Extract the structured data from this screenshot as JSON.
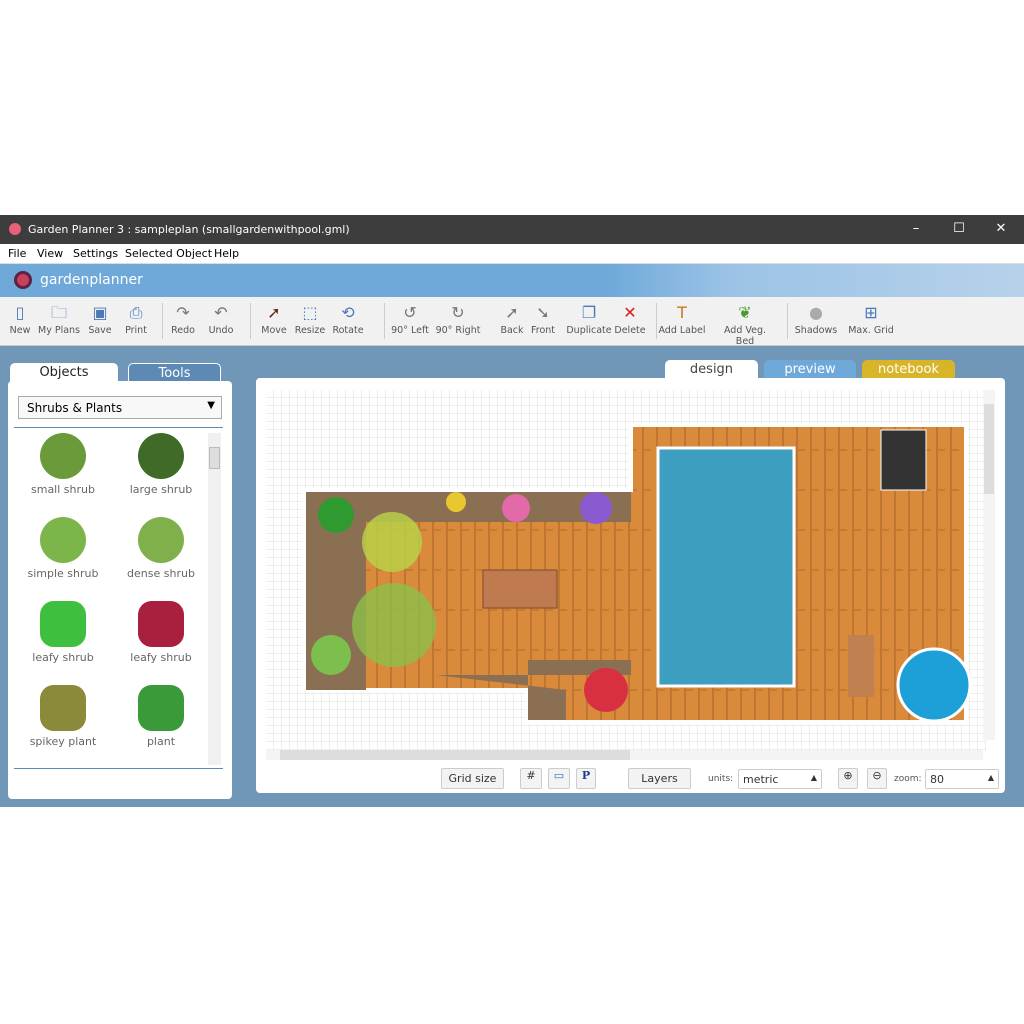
{
  "window": {
    "title": "Garden Planner 3 : sampleplan (smallgardenwithpool.gml)",
    "minimize": "–",
    "maximize": "☐",
    "close": "✕"
  },
  "menu": [
    "File",
    "View",
    "Settings",
    "Selected Object",
    "Help"
  ],
  "brand": "gardenplanner",
  "toolbar": [
    {
      "label": "New",
      "icon": "new-document-icon",
      "glyph": "▯"
    },
    {
      "label": "My Plans",
      "icon": "folder-icon",
      "glyph": "🗀"
    },
    {
      "label": "Save",
      "icon": "save-icon",
      "glyph": "▣"
    },
    {
      "label": "Print",
      "icon": "print-icon",
      "glyph": "⎙"
    },
    {
      "label": "Redo",
      "icon": "redo-icon",
      "glyph": "↷"
    },
    {
      "label": "Undo",
      "icon": "undo-icon",
      "glyph": "↶"
    },
    {
      "label": "Move",
      "icon": "arrow-cursor-icon",
      "glyph": "➚"
    },
    {
      "label": "Resize",
      "icon": "resize-icon",
      "glyph": "⬚"
    },
    {
      "label": "Rotate",
      "icon": "rotate-icon",
      "glyph": "⟲"
    },
    {
      "label": "90° Left",
      "icon": "rotate-left-icon",
      "glyph": "↺"
    },
    {
      "label": "90° Right",
      "icon": "rotate-right-icon",
      "glyph": "↻"
    },
    {
      "label": "Back",
      "icon": "send-back-icon",
      "glyph": "➚"
    },
    {
      "label": "Front",
      "icon": "bring-front-icon",
      "glyph": "➘"
    },
    {
      "label": "Duplicate",
      "icon": "duplicate-icon",
      "glyph": "❐"
    },
    {
      "label": "Delete",
      "icon": "delete-icon",
      "glyph": "✕"
    },
    {
      "label": "Add Label",
      "icon": "text-label-icon",
      "glyph": "T"
    },
    {
      "label": "Add Veg. Bed",
      "icon": "vegetable-icon",
      "glyph": "❦"
    },
    {
      "label": "Shadows",
      "icon": "shadows-icon",
      "glyph": "●"
    },
    {
      "label": "Max. Grid",
      "icon": "max-grid-icon",
      "glyph": "⊞"
    }
  ],
  "left_panel": {
    "tabs": [
      "Objects",
      "Tools"
    ],
    "category": "Shrubs & Plants",
    "items": [
      {
        "label": "small shrub",
        "color": "#6a9a3a"
      },
      {
        "label": "large shrub",
        "color": "#3f6a28"
      },
      {
        "label": "simple shrub",
        "color": "#7cb64a"
      },
      {
        "label": "dense shrub",
        "color": "#7fb04c"
      },
      {
        "label": "leafy shrub",
        "color": "#3fbf3f"
      },
      {
        "label": "leafy shrub",
        "color": "#a8203e"
      },
      {
        "label": "spikey plant",
        "color": "#8a8a3a"
      },
      {
        "label": "plant",
        "color": "#3a9a3a"
      }
    ]
  },
  "view_tabs": [
    "design",
    "preview",
    "notebook"
  ],
  "bottom_bar": {
    "grid_size": "Grid size",
    "layers": "Layers",
    "units_label": "units:",
    "units_value": "metric",
    "zoom_label": "zoom:",
    "zoom_value": "80"
  }
}
